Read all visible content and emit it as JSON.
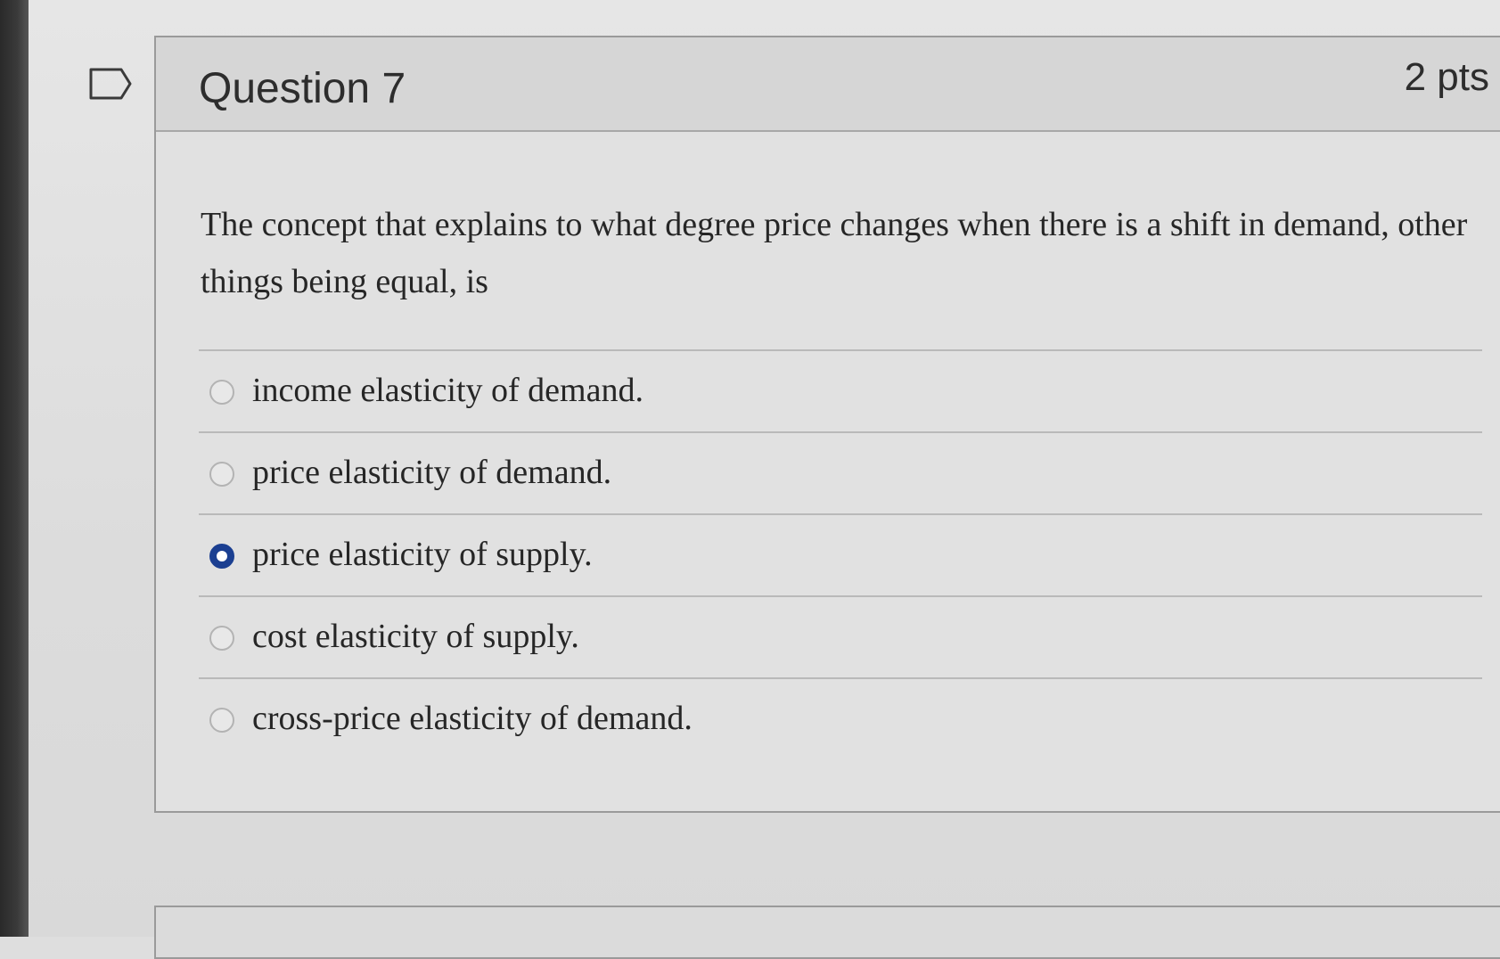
{
  "question": {
    "title": "Question 7",
    "points": "2 pts",
    "text": "The concept that explains to what degree price changes when there is a shift in demand, other things being equal, is",
    "answers": [
      {
        "label": "income elasticity of demand.",
        "selected": false
      },
      {
        "label": "price elasticity of demand.",
        "selected": false
      },
      {
        "label": "price elasticity of supply.",
        "selected": true
      },
      {
        "label": "cost elasticity of supply.",
        "selected": false
      },
      {
        "label": "cross-price elasticity of demand.",
        "selected": false
      }
    ]
  },
  "colors": {
    "selected_radio": "#1b3f91",
    "background": "#e1e1e1"
  },
  "icons": {
    "flag": "bookmark-flag-icon"
  }
}
